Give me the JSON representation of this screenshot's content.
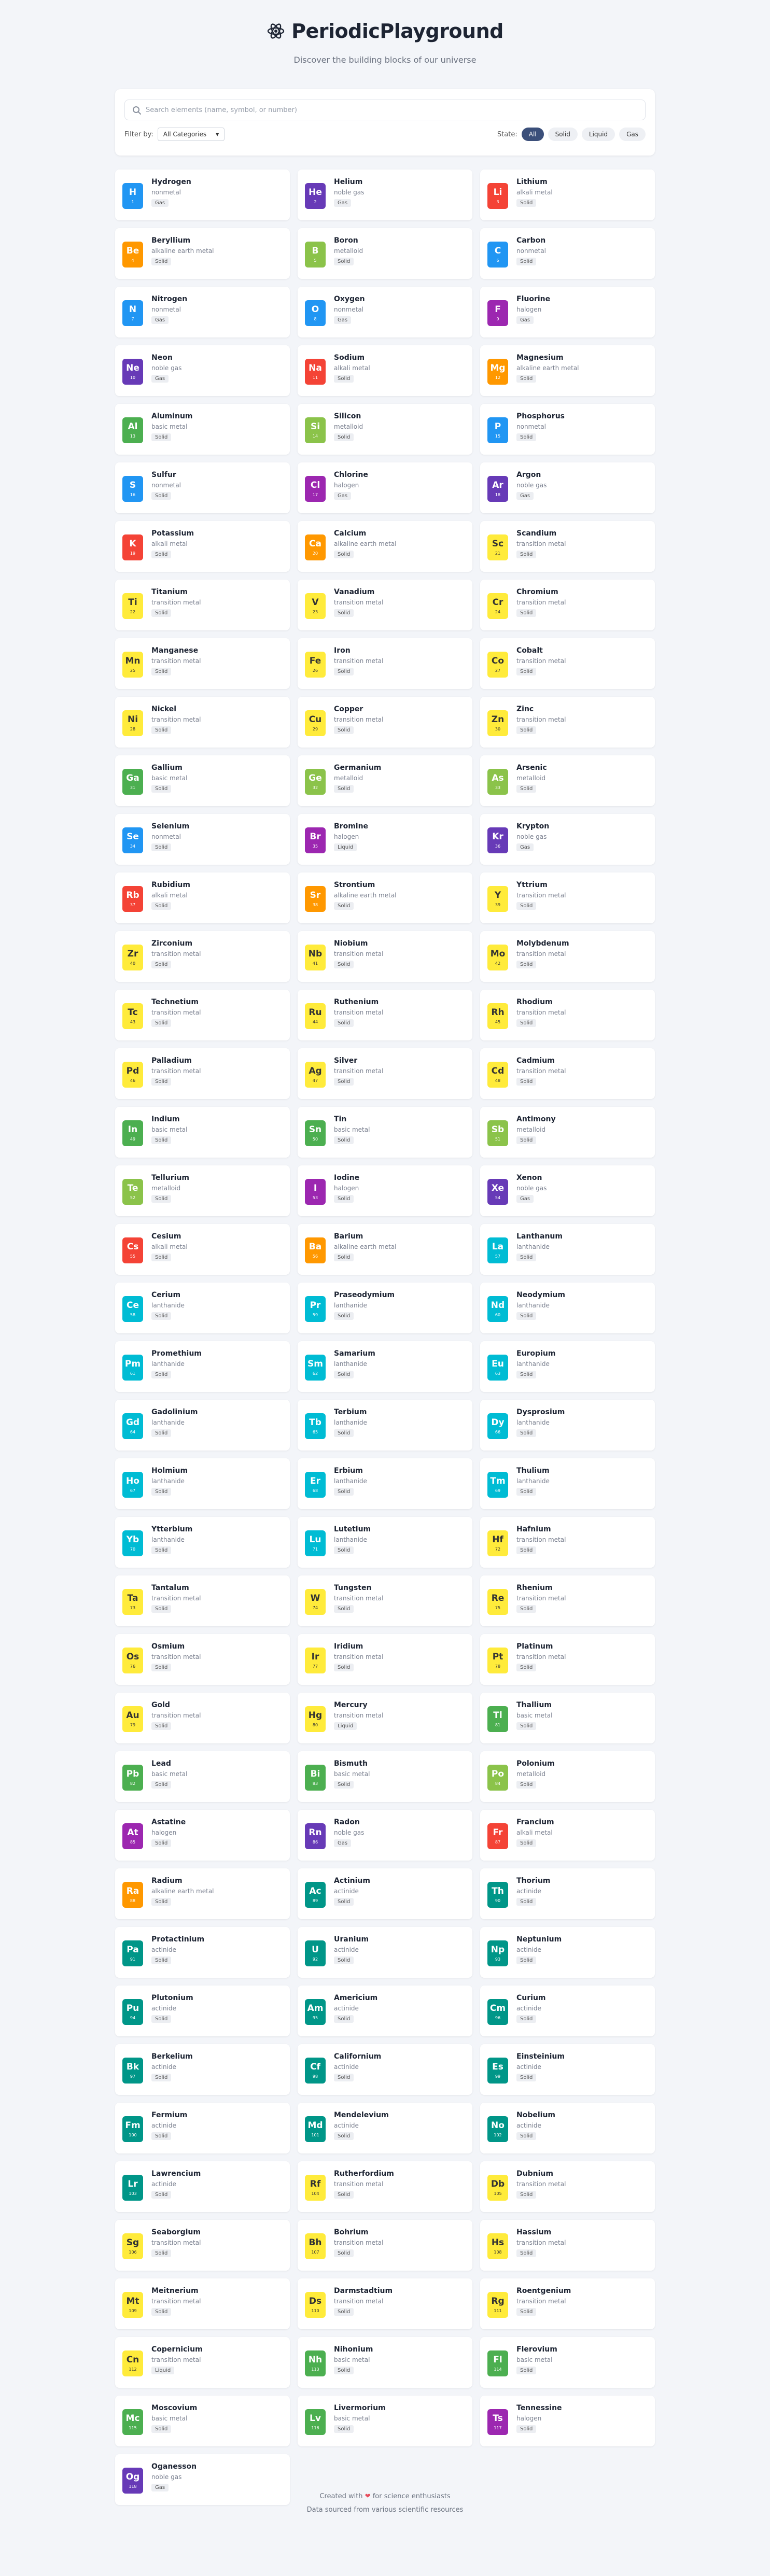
{
  "header": {
    "title": "PeriodicPlayground",
    "subtitle": "Discover the building blocks of our universe"
  },
  "search": {
    "placeholder": "Search elements (name, symbol, or number)"
  },
  "filter": {
    "label": "Filter by:",
    "selected": "All Categories"
  },
  "state": {
    "label": "State:",
    "options": [
      "All",
      "Solid",
      "Liquid",
      "Gas"
    ],
    "active": "All"
  },
  "colors": {
    "nonmetal": "#2196f3",
    "noble gas": "#673ab7",
    "alkali metal": "#f44336",
    "alkaline earth metal": "#ff9800",
    "metalloid": "#8bc34a",
    "halogen": "#9c27b0",
    "basic metal": "#4caf50",
    "transition metal": "#ffeb3b",
    "lanthanide": "#00bcd4",
    "actinide": "#009688"
  },
  "elements": [
    {
      "name": "Hydrogen",
      "symbol": "H",
      "number": 1,
      "category": "nonmetal",
      "state": "Gas"
    },
    {
      "name": "Helium",
      "symbol": "He",
      "number": 2,
      "category": "noble gas",
      "state": "Gas"
    },
    {
      "name": "Lithium",
      "symbol": "Li",
      "number": 3,
      "category": "alkali metal",
      "state": "Solid"
    },
    {
      "name": "Beryllium",
      "symbol": "Be",
      "number": 4,
      "category": "alkaline earth metal",
      "state": "Solid"
    },
    {
      "name": "Boron",
      "symbol": "B",
      "number": 5,
      "category": "metalloid",
      "state": "Solid"
    },
    {
      "name": "Carbon",
      "symbol": "C",
      "number": 6,
      "category": "nonmetal",
      "state": "Solid"
    },
    {
      "name": "Nitrogen",
      "symbol": "N",
      "number": 7,
      "category": "nonmetal",
      "state": "Gas"
    },
    {
      "name": "Oxygen",
      "symbol": "O",
      "number": 8,
      "category": "nonmetal",
      "state": "Gas"
    },
    {
      "name": "Fluorine",
      "symbol": "F",
      "number": 9,
      "category": "halogen",
      "state": "Gas"
    },
    {
      "name": "Neon",
      "symbol": "Ne",
      "number": 10,
      "category": "noble gas",
      "state": "Gas"
    },
    {
      "name": "Sodium",
      "symbol": "Na",
      "number": 11,
      "category": "alkali metal",
      "state": "Solid"
    },
    {
      "name": "Magnesium",
      "symbol": "Mg",
      "number": 12,
      "category": "alkaline earth metal",
      "state": "Solid"
    },
    {
      "name": "Aluminum",
      "symbol": "Al",
      "number": 13,
      "category": "basic metal",
      "state": "Solid"
    },
    {
      "name": "Silicon",
      "symbol": "Si",
      "number": 14,
      "category": "metalloid",
      "state": "Solid"
    },
    {
      "name": "Phosphorus",
      "symbol": "P",
      "number": 15,
      "category": "nonmetal",
      "state": "Solid"
    },
    {
      "name": "Sulfur",
      "symbol": "S",
      "number": 16,
      "category": "nonmetal",
      "state": "Solid"
    },
    {
      "name": "Chlorine",
      "symbol": "Cl",
      "number": 17,
      "category": "halogen",
      "state": "Gas"
    },
    {
      "name": "Argon",
      "symbol": "Ar",
      "number": 18,
      "category": "noble gas",
      "state": "Gas"
    },
    {
      "name": "Potassium",
      "symbol": "K",
      "number": 19,
      "category": "alkali metal",
      "state": "Solid"
    },
    {
      "name": "Calcium",
      "symbol": "Ca",
      "number": 20,
      "category": "alkaline earth metal",
      "state": "Solid"
    },
    {
      "name": "Scandium",
      "symbol": "Sc",
      "number": 21,
      "category": "transition metal",
      "state": "Solid"
    },
    {
      "name": "Titanium",
      "symbol": "Ti",
      "number": 22,
      "category": "transition metal",
      "state": "Solid"
    },
    {
      "name": "Vanadium",
      "symbol": "V",
      "number": 23,
      "category": "transition metal",
      "state": "Solid"
    },
    {
      "name": "Chromium",
      "symbol": "Cr",
      "number": 24,
      "category": "transition metal",
      "state": "Solid"
    },
    {
      "name": "Manganese",
      "symbol": "Mn",
      "number": 25,
      "category": "transition metal",
      "state": "Solid"
    },
    {
      "name": "Iron",
      "symbol": "Fe",
      "number": 26,
      "category": "transition metal",
      "state": "Solid"
    },
    {
      "name": "Cobalt",
      "symbol": "Co",
      "number": 27,
      "category": "transition metal",
      "state": "Solid"
    },
    {
      "name": "Nickel",
      "symbol": "Ni",
      "number": 28,
      "category": "transition metal",
      "state": "Solid"
    },
    {
      "name": "Copper",
      "symbol": "Cu",
      "number": 29,
      "category": "transition metal",
      "state": "Solid"
    },
    {
      "name": "Zinc",
      "symbol": "Zn",
      "number": 30,
      "category": "transition metal",
      "state": "Solid"
    },
    {
      "name": "Gallium",
      "symbol": "Ga",
      "number": 31,
      "category": "basic metal",
      "state": "Solid"
    },
    {
      "name": "Germanium",
      "symbol": "Ge",
      "number": 32,
      "category": "metalloid",
      "state": "Solid"
    },
    {
      "name": "Arsenic",
      "symbol": "As",
      "number": 33,
      "category": "metalloid",
      "state": "Solid"
    },
    {
      "name": "Selenium",
      "symbol": "Se",
      "number": 34,
      "category": "nonmetal",
      "state": "Solid"
    },
    {
      "name": "Bromine",
      "symbol": "Br",
      "number": 35,
      "category": "halogen",
      "state": "Liquid"
    },
    {
      "name": "Krypton",
      "symbol": "Kr",
      "number": 36,
      "category": "noble gas",
      "state": "Gas"
    },
    {
      "name": "Rubidium",
      "symbol": "Rb",
      "number": 37,
      "category": "alkali metal",
      "state": "Solid"
    },
    {
      "name": "Strontium",
      "symbol": "Sr",
      "number": 38,
      "category": "alkaline earth metal",
      "state": "Solid"
    },
    {
      "name": "Yttrium",
      "symbol": "Y",
      "number": 39,
      "category": "transition metal",
      "state": "Solid"
    },
    {
      "name": "Zirconium",
      "symbol": "Zr",
      "number": 40,
      "category": "transition metal",
      "state": "Solid"
    },
    {
      "name": "Niobium",
      "symbol": "Nb",
      "number": 41,
      "category": "transition metal",
      "state": "Solid"
    },
    {
      "name": "Molybdenum",
      "symbol": "Mo",
      "number": 42,
      "category": "transition metal",
      "state": "Solid"
    },
    {
      "name": "Technetium",
      "symbol": "Tc",
      "number": 43,
      "category": "transition metal",
      "state": "Solid"
    },
    {
      "name": "Ruthenium",
      "symbol": "Ru",
      "number": 44,
      "category": "transition metal",
      "state": "Solid"
    },
    {
      "name": "Rhodium",
      "symbol": "Rh",
      "number": 45,
      "category": "transition metal",
      "state": "Solid"
    },
    {
      "name": "Palladium",
      "symbol": "Pd",
      "number": 46,
      "category": "transition metal",
      "state": "Solid"
    },
    {
      "name": "Silver",
      "symbol": "Ag",
      "number": 47,
      "category": "transition metal",
      "state": "Solid"
    },
    {
      "name": "Cadmium",
      "symbol": "Cd",
      "number": 48,
      "category": "transition metal",
      "state": "Solid"
    },
    {
      "name": "Indium",
      "symbol": "In",
      "number": 49,
      "category": "basic metal",
      "state": "Solid"
    },
    {
      "name": "Tin",
      "symbol": "Sn",
      "number": 50,
      "category": "basic metal",
      "state": "Solid"
    },
    {
      "name": "Antimony",
      "symbol": "Sb",
      "number": 51,
      "category": "metalloid",
      "state": "Solid"
    },
    {
      "name": "Tellurium",
      "symbol": "Te",
      "number": 52,
      "category": "metalloid",
      "state": "Solid"
    },
    {
      "name": "Iodine",
      "symbol": "I",
      "number": 53,
      "category": "halogen",
      "state": "Solid"
    },
    {
      "name": "Xenon",
      "symbol": "Xe",
      "number": 54,
      "category": "noble gas",
      "state": "Gas"
    },
    {
      "name": "Cesium",
      "symbol": "Cs",
      "number": 55,
      "category": "alkali metal",
      "state": "Solid"
    },
    {
      "name": "Barium",
      "symbol": "Ba",
      "number": 56,
      "category": "alkaline earth metal",
      "state": "Solid"
    },
    {
      "name": "Lanthanum",
      "symbol": "La",
      "number": 57,
      "category": "lanthanide",
      "state": "Solid"
    },
    {
      "name": "Cerium",
      "symbol": "Ce",
      "number": 58,
      "category": "lanthanide",
      "state": "Solid"
    },
    {
      "name": "Praseodymium",
      "symbol": "Pr",
      "number": 59,
      "category": "lanthanide",
      "state": "Solid"
    },
    {
      "name": "Neodymium",
      "symbol": "Nd",
      "number": 60,
      "category": "lanthanide",
      "state": "Solid"
    },
    {
      "name": "Promethium",
      "symbol": "Pm",
      "number": 61,
      "category": "lanthanide",
      "state": "Solid"
    },
    {
      "name": "Samarium",
      "symbol": "Sm",
      "number": 62,
      "category": "lanthanide",
      "state": "Solid"
    },
    {
      "name": "Europium",
      "symbol": "Eu",
      "number": 63,
      "category": "lanthanide",
      "state": "Solid"
    },
    {
      "name": "Gadolinium",
      "symbol": "Gd",
      "number": 64,
      "category": "lanthanide",
      "state": "Solid"
    },
    {
      "name": "Terbium",
      "symbol": "Tb",
      "number": 65,
      "category": "lanthanide",
      "state": "Solid"
    },
    {
      "name": "Dysprosium",
      "symbol": "Dy",
      "number": 66,
      "category": "lanthanide",
      "state": "Solid"
    },
    {
      "name": "Holmium",
      "symbol": "Ho",
      "number": 67,
      "category": "lanthanide",
      "state": "Solid"
    },
    {
      "name": "Erbium",
      "symbol": "Er",
      "number": 68,
      "category": "lanthanide",
      "state": "Solid"
    },
    {
      "name": "Thulium",
      "symbol": "Tm",
      "number": 69,
      "category": "lanthanide",
      "state": "Solid"
    },
    {
      "name": "Ytterbium",
      "symbol": "Yb",
      "number": 70,
      "category": "lanthanide",
      "state": "Solid"
    },
    {
      "name": "Lutetium",
      "symbol": "Lu",
      "number": 71,
      "category": "lanthanide",
      "state": "Solid"
    },
    {
      "name": "Hafnium",
      "symbol": "Hf",
      "number": 72,
      "category": "transition metal",
      "state": "Solid"
    },
    {
      "name": "Tantalum",
      "symbol": "Ta",
      "number": 73,
      "category": "transition metal",
      "state": "Solid"
    },
    {
      "name": "Tungsten",
      "symbol": "W",
      "number": 74,
      "category": "transition metal",
      "state": "Solid"
    },
    {
      "name": "Rhenium",
      "symbol": "Re",
      "number": 75,
      "category": "transition metal",
      "state": "Solid"
    },
    {
      "name": "Osmium",
      "symbol": "Os",
      "number": 76,
      "category": "transition metal",
      "state": "Solid"
    },
    {
      "name": "Iridium",
      "symbol": "Ir",
      "number": 77,
      "category": "transition metal",
      "state": "Solid"
    },
    {
      "name": "Platinum",
      "symbol": "Pt",
      "number": 78,
      "category": "transition metal",
      "state": "Solid"
    },
    {
      "name": "Gold",
      "symbol": "Au",
      "number": 79,
      "category": "transition metal",
      "state": "Solid"
    },
    {
      "name": "Mercury",
      "symbol": "Hg",
      "number": 80,
      "category": "transition metal",
      "state": "Liquid"
    },
    {
      "name": "Thallium",
      "symbol": "Tl",
      "number": 81,
      "category": "basic metal",
      "state": "Solid"
    },
    {
      "name": "Lead",
      "symbol": "Pb",
      "number": 82,
      "category": "basic metal",
      "state": "Solid"
    },
    {
      "name": "Bismuth",
      "symbol": "Bi",
      "number": 83,
      "category": "basic metal",
      "state": "Solid"
    },
    {
      "name": "Polonium",
      "symbol": "Po",
      "number": 84,
      "category": "metalloid",
      "state": "Solid"
    },
    {
      "name": "Astatine",
      "symbol": "At",
      "number": 85,
      "category": "halogen",
      "state": "Solid"
    },
    {
      "name": "Radon",
      "symbol": "Rn",
      "number": 86,
      "category": "noble gas",
      "state": "Gas"
    },
    {
      "name": "Francium",
      "symbol": "Fr",
      "number": 87,
      "category": "alkali metal",
      "state": "Solid"
    },
    {
      "name": "Radium",
      "symbol": "Ra",
      "number": 88,
      "category": "alkaline earth metal",
      "state": "Solid"
    },
    {
      "name": "Actinium",
      "symbol": "Ac",
      "number": 89,
      "category": "actinide",
      "state": "Solid"
    },
    {
      "name": "Thorium",
      "symbol": "Th",
      "number": 90,
      "category": "actinide",
      "state": "Solid"
    },
    {
      "name": "Protactinium",
      "symbol": "Pa",
      "number": 91,
      "category": "actinide",
      "state": "Solid"
    },
    {
      "name": "Uranium",
      "symbol": "U",
      "number": 92,
      "category": "actinide",
      "state": "Solid"
    },
    {
      "name": "Neptunium",
      "symbol": "Np",
      "number": 93,
      "category": "actinide",
      "state": "Solid"
    },
    {
      "name": "Plutonium",
      "symbol": "Pu",
      "number": 94,
      "category": "actinide",
      "state": "Solid"
    },
    {
      "name": "Americium",
      "symbol": "Am",
      "number": 95,
      "category": "actinide",
      "state": "Solid"
    },
    {
      "name": "Curium",
      "symbol": "Cm",
      "number": 96,
      "category": "actinide",
      "state": "Solid"
    },
    {
      "name": "Berkelium",
      "symbol": "Bk",
      "number": 97,
      "category": "actinide",
      "state": "Solid"
    },
    {
      "name": "Californium",
      "symbol": "Cf",
      "number": 98,
      "category": "actinide",
      "state": "Solid"
    },
    {
      "name": "Einsteinium",
      "symbol": "Es",
      "number": 99,
      "category": "actinide",
      "state": "Solid"
    },
    {
      "name": "Fermium",
      "symbol": "Fm",
      "number": 100,
      "category": "actinide",
      "state": "Solid"
    },
    {
      "name": "Mendelevium",
      "symbol": "Md",
      "number": 101,
      "category": "actinide",
      "state": "Solid"
    },
    {
      "name": "Nobelium",
      "symbol": "No",
      "number": 102,
      "category": "actinide",
      "state": "Solid"
    },
    {
      "name": "Lawrencium",
      "symbol": "Lr",
      "number": 103,
      "category": "actinide",
      "state": "Solid"
    },
    {
      "name": "Rutherfordium",
      "symbol": "Rf",
      "number": 104,
      "category": "transition metal",
      "state": "Solid"
    },
    {
      "name": "Dubnium",
      "symbol": "Db",
      "number": 105,
      "category": "transition metal",
      "state": "Solid"
    },
    {
      "name": "Seaborgium",
      "symbol": "Sg",
      "number": 106,
      "category": "transition metal",
      "state": "Solid"
    },
    {
      "name": "Bohrium",
      "symbol": "Bh",
      "number": 107,
      "category": "transition metal",
      "state": "Solid"
    },
    {
      "name": "Hassium",
      "symbol": "Hs",
      "number": 108,
      "category": "transition metal",
      "state": "Solid"
    },
    {
      "name": "Meitnerium",
      "symbol": "Mt",
      "number": 109,
      "category": "transition metal",
      "state": "Solid"
    },
    {
      "name": "Darmstadtium",
      "symbol": "Ds",
      "number": 110,
      "category": "transition metal",
      "state": "Solid"
    },
    {
      "name": "Roentgenium",
      "symbol": "Rg",
      "number": 111,
      "category": "transition metal",
      "state": "Solid"
    },
    {
      "name": "Copernicium",
      "symbol": "Cn",
      "number": 112,
      "category": "transition metal",
      "state": "Liquid"
    },
    {
      "name": "Nihonium",
      "symbol": "Nh",
      "number": 113,
      "category": "basic metal",
      "state": "Solid"
    },
    {
      "name": "Flerovium",
      "symbol": "Fl",
      "number": 114,
      "category": "basic metal",
      "state": "Solid"
    },
    {
      "name": "Moscovium",
      "symbol": "Mc",
      "number": 115,
      "category": "basic metal",
      "state": "Solid"
    },
    {
      "name": "Livermorium",
      "symbol": "Lv",
      "number": 116,
      "category": "basic metal",
      "state": "Solid"
    },
    {
      "name": "Tennessine",
      "symbol": "Ts",
      "number": 117,
      "category": "halogen",
      "state": "Solid"
    },
    {
      "name": "Oganesson",
      "symbol": "Og",
      "number": 118,
      "category": "noble gas",
      "state": "Gas"
    }
  ],
  "footer": {
    "line1_prefix": "Created with",
    "line1_suffix": "for science enthusiasts",
    "line2": "Data sourced from various scientific resources"
  }
}
